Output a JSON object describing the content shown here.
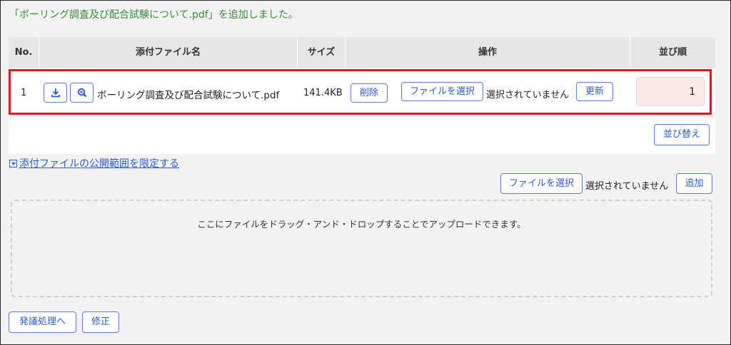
{
  "message": "「ボーリング調査及び配合試験について.pdf」を追加しました。",
  "table": {
    "headers": {
      "no": "No.",
      "file_name": "添付ファイル名",
      "size": "サイズ",
      "operation": "操作",
      "order": "並び順"
    },
    "row": {
      "no": "1",
      "file_name": "ボーリング調査及び配合試験について.pdf",
      "size": "141.4KB",
      "delete_label": "削除",
      "choose_file_label": "ファイルを選択",
      "no_file_text": "選択されていません",
      "update_label": "更新",
      "order_value": "1"
    },
    "sort_label": "並び替え"
  },
  "restrict_toggle_label": "添付ファイルの公開範囲を限定する",
  "upload": {
    "choose_file_label": "ファイルを選択",
    "no_file_text": "選択されていません",
    "add_label": "追加"
  },
  "dropzone_text": "ここにファイルをドラッグ・アンド・ドロップすることでアップロードできます。",
  "footer": {
    "dispatch_label": "発議処理へ",
    "edit_label": "修正"
  },
  "colors": {
    "highlight": "#e0141e",
    "accent": "#2d5cc8",
    "message": "#3a8a3a",
    "order_bg": "#fde8e8"
  },
  "icons": {
    "download": "download-icon",
    "preview": "zoom-icon",
    "toggle": "caret-down-box-icon"
  }
}
